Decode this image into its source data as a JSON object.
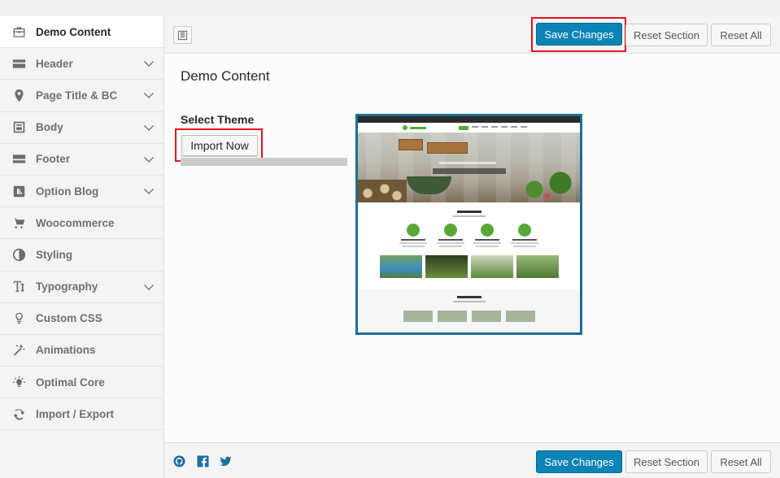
{
  "sidebar": {
    "items": [
      {
        "label": "Demo Content",
        "icon": "briefcase-icon",
        "active": true,
        "has_children": false
      },
      {
        "label": "Header",
        "icon": "header-bar-icon",
        "active": false,
        "has_children": true
      },
      {
        "label": "Page Title & BC",
        "icon": "location-pin-icon",
        "active": false,
        "has_children": true
      },
      {
        "label": "Body",
        "icon": "body-layout-icon",
        "active": false,
        "has_children": true
      },
      {
        "label": "Footer",
        "icon": "footer-bar-icon",
        "active": false,
        "has_children": true
      },
      {
        "label": "Option Blog",
        "icon": "blogger-icon",
        "active": false,
        "has_children": true
      },
      {
        "label": "Woocommerce",
        "icon": "cart-icon",
        "active": false,
        "has_children": false
      },
      {
        "label": "Styling",
        "icon": "contrast-icon",
        "active": false,
        "has_children": false
      },
      {
        "label": "Typography",
        "icon": "text-height-icon",
        "active": false,
        "has_children": true
      },
      {
        "label": "Custom CSS",
        "icon": "lightbulb-icon",
        "active": false,
        "has_children": false
      },
      {
        "label": "Animations",
        "icon": "magic-wand-icon",
        "active": false,
        "has_children": false
      },
      {
        "label": "Optimal Core",
        "icon": "bulb-rays-icon",
        "active": false,
        "has_children": false
      },
      {
        "label": "Import / Export",
        "icon": "refresh-icon",
        "active": false,
        "has_children": false
      }
    ]
  },
  "toolbar": {
    "save_label": "Save Changes",
    "reset_section_label": "Reset Section",
    "reset_all_label": "Reset All"
  },
  "main": {
    "section_title": "Demo Content",
    "field_label": "Select Theme",
    "import_button_label": "Import Now"
  },
  "footer": {
    "save_label": "Save Changes",
    "reset_section_label": "Reset Section",
    "reset_all_label": "Reset All",
    "social": [
      "github-icon",
      "facebook-icon",
      "twitter-icon"
    ]
  },
  "colors": {
    "primary_button": "#0c83b5",
    "highlight": "#e3131b",
    "preview_border": "#1e6e97",
    "accent_green": "#5aa839"
  }
}
